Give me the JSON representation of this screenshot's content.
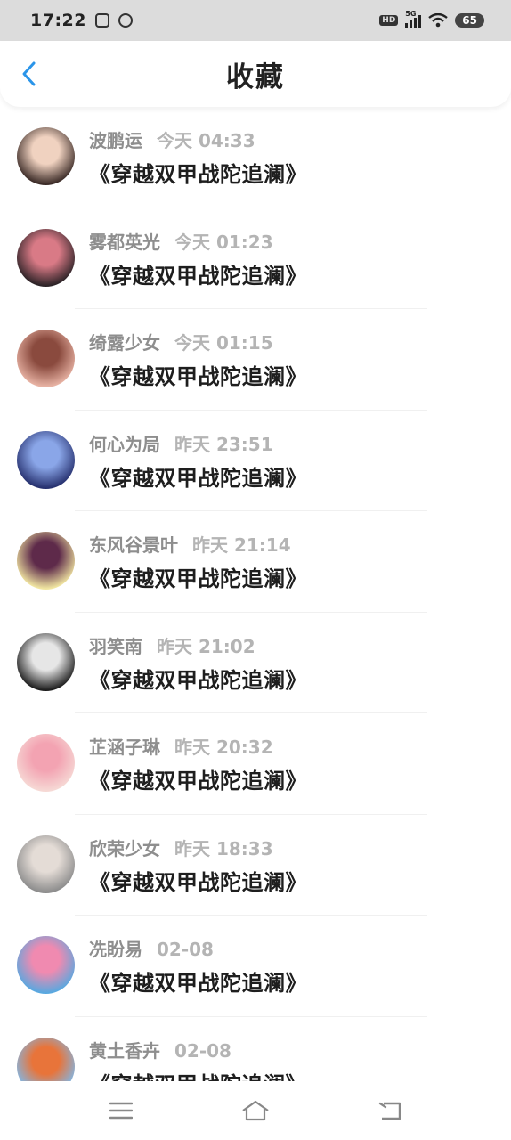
{
  "status_bar": {
    "time": "17:22",
    "hd": "HD",
    "network": "5G",
    "battery": "65"
  },
  "header": {
    "title": "收藏",
    "back_icon": "chevron-left-icon",
    "accent_color": "#2b95e9"
  },
  "items": [
    {
      "user": "波鹏运",
      "time": "今天 04:33",
      "title": "《穿越双甲战陀追澜》",
      "avatar_colors": [
        "#3a2a26",
        "#f0d2c0"
      ]
    },
    {
      "user": "雾都英光",
      "time": "今天 01:23",
      "title": "《穿越双甲战陀追澜》",
      "avatar_colors": [
        "#2b2226",
        "#d97a86"
      ]
    },
    {
      "user": "绮露少女",
      "time": "今天 01:15",
      "title": "《穿越双甲战陀追澜》",
      "avatar_colors": [
        "#e8b3a4",
        "#8a4a3e"
      ]
    },
    {
      "user": "何心为局",
      "time": "昨天 23:51",
      "title": "《穿越双甲战陀追澜》",
      "avatar_colors": [
        "#26306e",
        "#8aa6e8"
      ]
    },
    {
      "user": "东风谷景叶",
      "time": "昨天 21:14",
      "title": "《穿越双甲战陀追澜》",
      "avatar_colors": [
        "#f2e7a2",
        "#5e2a4a"
      ]
    },
    {
      "user": "羽笑南",
      "time": "昨天 21:02",
      "title": "《穿越双甲战陀追澜》",
      "avatar_colors": [
        "#1c1c1c",
        "#e6e6e6"
      ]
    },
    {
      "user": "芷涵子琳",
      "time": "昨天 20:32",
      "title": "《穿越双甲战陀追澜》",
      "avatar_colors": [
        "#f6d9d5",
        "#f3a3b2"
      ]
    },
    {
      "user": "欣荣少女",
      "time": "昨天 18:33",
      "title": "《穿越双甲战陀追澜》",
      "avatar_colors": [
        "#8c8c8c",
        "#e4dcd6"
      ]
    },
    {
      "user": "冼盼易",
      "time": "02-08",
      "title": "《穿越双甲战陀追澜》",
      "avatar_colors": [
        "#58a8e0",
        "#f08ab0"
      ]
    },
    {
      "user": "黄土香卉",
      "time": "02-08",
      "title": "《穿越双甲战陀追澜》",
      "avatar_colors": [
        "#7fb8e8",
        "#e8743a"
      ]
    }
  ],
  "bottom_nav": {
    "menu_icon": "menu-icon",
    "home_icon": "home-icon",
    "back_icon": "back-icon",
    "icon_color": "#888888"
  }
}
